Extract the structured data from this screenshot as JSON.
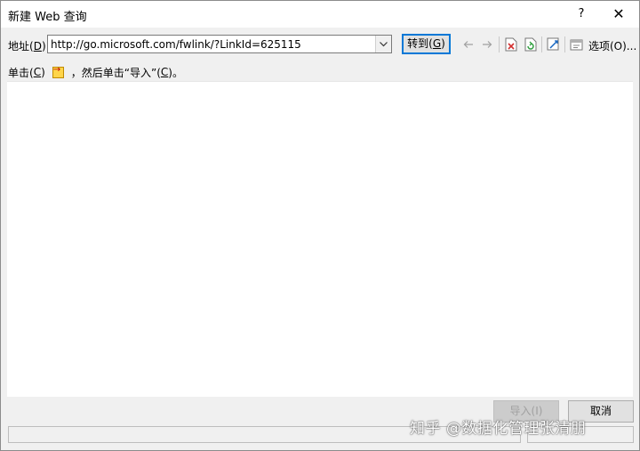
{
  "window": {
    "title": "新建 Web 查询",
    "help_label": "?",
    "close_label": "✕"
  },
  "toolbar": {
    "address_label_pre": "地址(",
    "address_label_key": "D",
    "address_label_post": "):",
    "address_value": "http://go.microsoft.com/fwlink/?LinkId=625115",
    "goto_label_pre": "转到(",
    "goto_label_key": "G",
    "goto_label_post": ")",
    "options_label": "选项(O)..."
  },
  "hint": {
    "pre": "单击(",
    "key": "C",
    "post": ")",
    "mid": "，然后单击“导入”(",
    "key2": "C",
    "end": ")。"
  },
  "buttons": {
    "import_label": "导入(I)",
    "cancel_label": "取消"
  },
  "watermark": {
    "text": "知乎 @数据化管理张清朋"
  },
  "colors": {
    "accent": "#0078d7",
    "dialog_bg": "#f0f0f0"
  }
}
